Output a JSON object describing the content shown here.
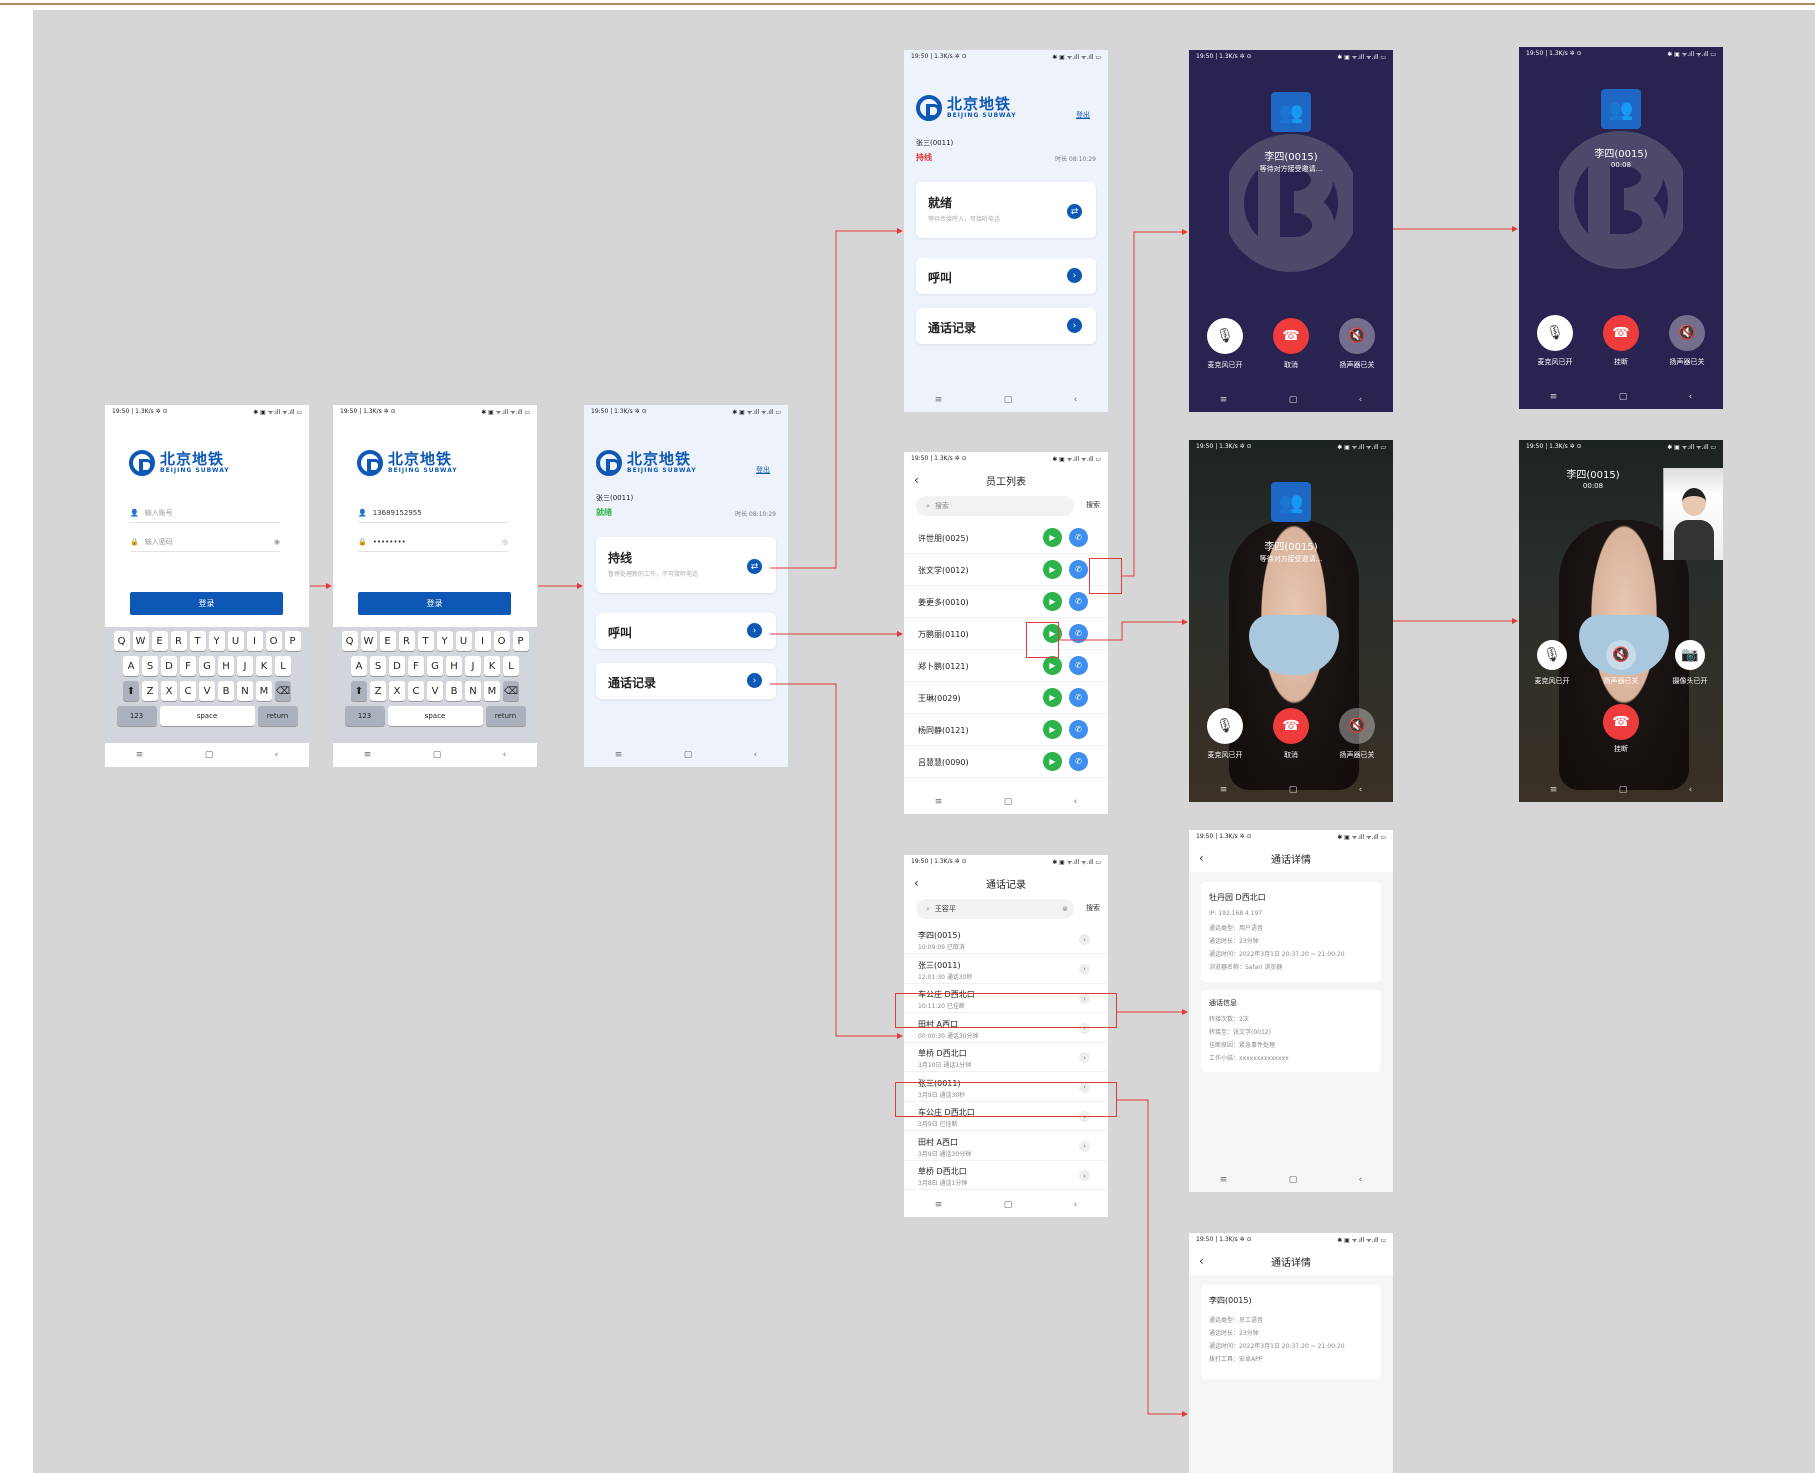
{
  "status": {
    "left": "19:50 | 1.3K/s ✲ ⊙",
    "right": "✱ ▣ ᯤ.ıll ᯤ.ıll ▭"
  },
  "nav": {
    "menu": "≡",
    "home": "▢",
    "back": "‹"
  },
  "logo": {
    "cn": "北京地铁",
    "en": "BEIJING SUBWAY"
  },
  "login": {
    "account_placeholder": "输入账号",
    "password_placeholder": "输入密码",
    "account_value": "13689152955",
    "password_value": "••••••••",
    "login_button": "登录",
    "keyboard": {
      "row1": [
        "Q",
        "W",
        "E",
        "R",
        "T",
        "Y",
        "U",
        "I",
        "O",
        "P"
      ],
      "row2": [
        "A",
        "S",
        "D",
        "F",
        "G",
        "H",
        "J",
        "K",
        "L"
      ],
      "row3": [
        "Z",
        "X",
        "C",
        "V",
        "B",
        "N",
        "M"
      ],
      "shift": "⬆",
      "delete": "⌫",
      "num": "123",
      "space": "space",
      "return": "return"
    }
  },
  "home": {
    "logout": "登出",
    "user": "张三(0011)",
    "status_ready": "就绪",
    "status_hold": "持线",
    "duration": "时长 08:10:29",
    "hold_card_title": "持线",
    "hold_card_sub": "暂停处理新的工作，不可接听电话",
    "ready_card_title": "就绪",
    "ready_card_sub": "等待传接呼入，可接听电话",
    "call_card": "呼叫",
    "record_card": "通话记录",
    "swap_icon": "⇄",
    "arrow_icon": "›"
  },
  "staff": {
    "title": "员工列表",
    "search_placeholder": "搜索",
    "search_button": "搜索",
    "items": [
      "许世朋(0025)",
      "张文学(0012)",
      "姜更多(0010)",
      "万鹏丽(0110)",
      "郑卜鹏(0121)",
      "王琳(0029)",
      "杨同静(0121)",
      "吕慧慧(0090)"
    ]
  },
  "records": {
    "title": "通话记录",
    "search_value": "王容平",
    "search_button": "搜索",
    "items": [
      {
        "name": "李四(0015)",
        "detail": "10:09:09  已取消"
      },
      {
        "name": "张三(0011)",
        "detail": "12:01:30  通话30秒"
      },
      {
        "name": "车公庄 D西北口",
        "detail": "10:11:20  已挂断"
      },
      {
        "name": "田村 A西口",
        "detail": "00:00:30  通话30分钟"
      },
      {
        "name": "草桥 D西北口",
        "detail": "3月10日  通话1分钟"
      },
      {
        "name": "张三(0011)",
        "detail": "3月9日  通话30秒"
      },
      {
        "name": "车公庄 D西北口",
        "detail": "3月9日  已挂断"
      },
      {
        "name": "田村 A西口",
        "detail": "3月9日  通话30分钟"
      },
      {
        "name": "草桥 D西北口",
        "detail": "3月8日  通话1分钟"
      }
    ]
  },
  "call_wait": {
    "name": "李四(0015)",
    "status": "等待对方接受邀请...",
    "mic": "麦克风已开",
    "cancel": "取消",
    "speaker": "扬声器已关"
  },
  "call_active": {
    "name": "李四(0015)",
    "timer": "00:08",
    "mic": "麦克风已开",
    "hangup": "挂断",
    "speaker": "扬声器已关",
    "camera": "摄像头已开"
  },
  "detail1": {
    "title": "通话详情",
    "station": "牡丹园 D西北口",
    "lines": [
      "IP: 192.168.4.197",
      "通话类型：用户语音",
      "通话时长：23分钟",
      "通话时间：2022年3月1日 20:37:20 ~ 21:00:20",
      "浏览器名称：Safari 浏览器"
    ],
    "info_title": "通话信息",
    "info_lines": [
      "转接次数：2次",
      "转接至：张文学(0012)",
      "挂断原因：紧急事件处理",
      "工作小结：xxxxxxxxxxxxxx"
    ]
  },
  "detail2": {
    "title": "通话详情",
    "name": "李四(0015)",
    "lines": [
      "通话类型：员工语音",
      "通话时长：23分钟",
      "通话时间：2022年3月1日 20:37:20 ~ 21:00:20",
      "拨打工具：安卓APP"
    ]
  },
  "colors": {
    "brand": "#0d57b5",
    "green": "#2db34a",
    "call_blue": "#3e8ff0",
    "hangup_red": "#ee3b3b",
    "link_red": "#e03a3a"
  }
}
